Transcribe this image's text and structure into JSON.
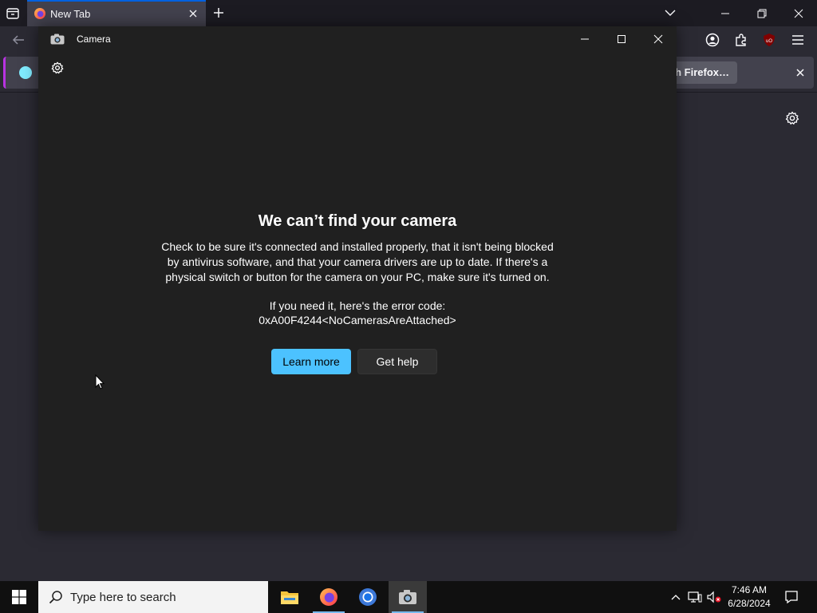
{
  "firefox": {
    "tab_title": "New Tab",
    "notice_button_label": "h Firefox…",
    "colors": {
      "tab_accent": "#0061e0",
      "notice_accent": "#b833e1"
    }
  },
  "camera": {
    "window_title": "Camera",
    "heading": "We can’t find your camera",
    "body": "Check to be sure it's connected and installed properly, that it isn't being blocked by antivirus software, and that your camera drivers are up to date. If there's a physical switch or button for the camera on your PC, make sure it's turned on.",
    "error_label": "If you need it, here's the error code:",
    "error_code": "0xA00F4244<NoCamerasAreAttached>",
    "buttons": {
      "learn_more": "Learn more",
      "get_help": "Get help"
    },
    "colors": {
      "accent": "#4cc2ff",
      "background": "#202020"
    }
  },
  "taskbar": {
    "search_placeholder": "Type here to search",
    "apps": [
      "file-explorer",
      "firefox",
      "chrome",
      "camera"
    ],
    "clock": {
      "time": "7:46 AM",
      "date": "6/28/2024"
    }
  }
}
